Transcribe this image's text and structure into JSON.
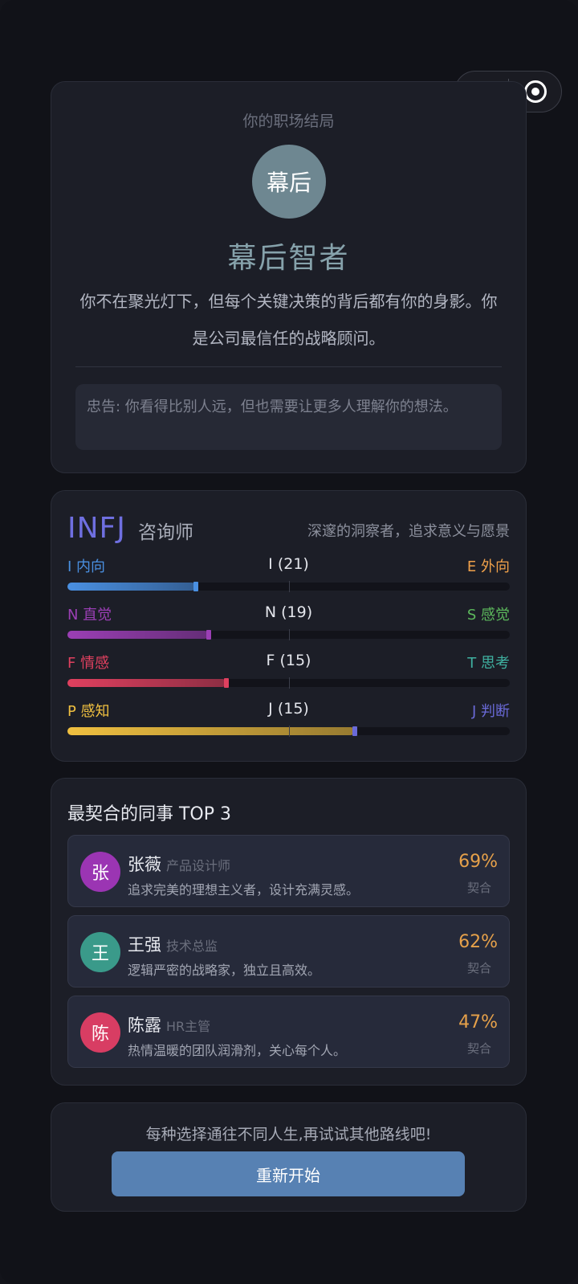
{
  "capsule": {
    "more_icon": "more-dots-icon",
    "close_icon": "target-icon"
  },
  "ending": {
    "subtitle": "你的职场结局",
    "avatar_text": "幕后",
    "title": "幕后智者",
    "description": "你不在聚光灯下，但每个关键决策的背后都有你的身影。你是公司最信任的战略顾问。",
    "advice": "忠告: 你看得比别人远，但也需要让更多人理解你的想法。"
  },
  "mbti": {
    "type": "INFJ",
    "role": "咨询师",
    "tagline": "深邃的洞察者，追求意义与愿景",
    "dimensions": [
      {
        "left": "I 内向",
        "center": "I (21)",
        "right": "E 外向",
        "value": 0.29,
        "color_left": "#4a90e2",
        "color_right": "#f0a14a"
      },
      {
        "left": "N 直觉",
        "center": "N (19)",
        "right": "S 感觉",
        "value": 0.32,
        "color_left": "#9b3fb5",
        "color_right": "#5cb85c"
      },
      {
        "left": "F 情感",
        "center": "F (15)",
        "right": "T 思考",
        "value": 0.36,
        "color_left": "#e0405f",
        "color_right": "#3fb0a0"
      },
      {
        "left": "P 感知",
        "center": "J (15)",
        "right": "J 判断",
        "value": 0.65,
        "color_left": "#f0c040",
        "color_right": "#6a6ad8"
      }
    ]
  },
  "colleagues": {
    "heading": "最契合的同事 TOP 3",
    "match_label": "契合",
    "items": [
      {
        "initial": "张",
        "name": "张薇",
        "job": "产品设计师",
        "blurb": "追求完美的理想主义者，设计充满灵感。",
        "percent": "69%",
        "color": "#9b35b3"
      },
      {
        "initial": "王",
        "name": "王强",
        "job": "技术总监",
        "blurb": "逻辑严密的战略家，独立且高效。",
        "percent": "62%",
        "color": "#3a9a8a"
      },
      {
        "initial": "陈",
        "name": "陈露",
        "job": "HR主管",
        "blurb": "热情温暖的团队润滑剂，关心每个人。",
        "percent": "47%",
        "color": "#d83d63"
      }
    ]
  },
  "restart": {
    "hint": "每种选择通往不同人生,再试试其他路线吧!",
    "button": "重新开始"
  }
}
